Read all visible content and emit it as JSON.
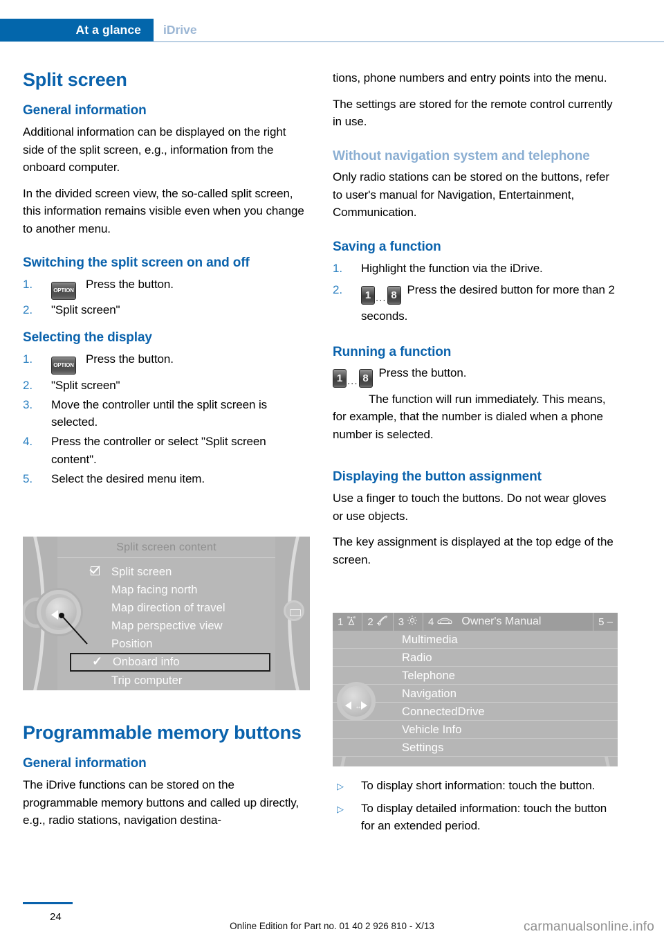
{
  "header": {
    "active_tab": "At a glance",
    "inactive_tab": "iDrive"
  },
  "colors": {
    "brand_blue": "#0366ab",
    "heading_blue": "#0a62ac",
    "heading_blue_light": "#8aaed2",
    "number_blue": "#2a7fc0"
  },
  "left_column": {
    "title": "Split screen",
    "sections": [
      {
        "heading": "General information",
        "paragraphs": [
          "Additional information can be displayed on the right side of the split screen, e.g., information from the onboard computer.",
          "In the divided screen view, the so-called split screen, this information remains visible even when you change to another menu."
        ]
      },
      {
        "heading": "Switching the split screen on and off",
        "steps": [
          {
            "num": "1.",
            "icon": "OPTION",
            "text": "Press the button."
          },
          {
            "num": "2.",
            "text": "\"Split screen\""
          }
        ]
      },
      {
        "heading": "Selecting the display",
        "steps": [
          {
            "num": "1.",
            "icon": "OPTION",
            "text": "Press the button."
          },
          {
            "num": "2.",
            "text": "\"Split screen\""
          },
          {
            "num": "3.",
            "text": "Move the controller until the split screen is selected."
          },
          {
            "num": "4.",
            "text": "Press the controller or select \"Split screen content\"."
          },
          {
            "num": "5.",
            "text": "Select the desired menu item."
          }
        ]
      }
    ],
    "title2": "Programmable memory buttons",
    "section2": {
      "heading": "General information",
      "paragraph": "The iDrive functions can be stored on the programmable memory buttons and called up directly, e.g., radio stations, navigation destina-"
    }
  },
  "figure_split_screen": {
    "title": "Split screen content",
    "items": [
      {
        "label": "Split screen",
        "marker": "checkbox-checked",
        "selected": false
      },
      {
        "label": "Map facing north",
        "marker": "none",
        "selected": false
      },
      {
        "label": "Map direction of travel",
        "marker": "none",
        "selected": false
      },
      {
        "label": "Map perspective view",
        "marker": "none",
        "selected": false
      },
      {
        "label": "Position",
        "marker": "none",
        "selected": false
      },
      {
        "label": "Onboard info",
        "marker": "tick",
        "selected": true
      },
      {
        "label": "Trip computer",
        "marker": "none",
        "selected": false
      }
    ]
  },
  "right_column": {
    "continued_paragraphs": [
      "tions, phone numbers and entry points into the menu.",
      "The settings are stored for the remote control currently in use."
    ],
    "sections": [
      {
        "heading": "Without navigation system and telephone",
        "heading_style": "light",
        "paragraphs": [
          "Only radio stations can be stored on the buttons, refer to user's manual for Navigation, Entertainment, Communication."
        ]
      },
      {
        "heading": "Saving a function",
        "steps": [
          {
            "num": "1.",
            "text": "Highlight the function via the iDrive."
          },
          {
            "num": "2.",
            "icon": "memory-buttons-1-to-8",
            "text": "Press the desired button for more than 2 seconds."
          }
        ]
      },
      {
        "heading": "Running a function",
        "inline_icon": "memory-buttons-1-to-8",
        "lines": [
          "Press the button.",
          "The function will run immediately. This means, for example, that the number is dialed when a phone number is selected."
        ]
      },
      {
        "heading": "Displaying the button assignment",
        "paragraphs": [
          "Use a finger to touch the buttons. Do not wear gloves or use objects.",
          "The key assignment is displayed at the top edge of the screen."
        ]
      }
    ],
    "arrow_items": [
      "To display short information: touch the button.",
      "To display detailed information: touch the button for an extended period."
    ]
  },
  "memory_keys": {
    "first": "1",
    "last": "8",
    "dots": "..."
  },
  "figure_owners_manual": {
    "topbar": [
      {
        "num": "1",
        "icon": "radio-antenna-icon"
      },
      {
        "num": "2",
        "icon": "telephone-icon"
      },
      {
        "num": "3",
        "icon": "gear-icon"
      },
      {
        "num": "4",
        "icon": "car-icon"
      }
    ],
    "topbar_title": "Owner's Manual",
    "topbar_last": "5 –",
    "rows": [
      "Multimedia",
      "Radio",
      "Telephone",
      "Navigation",
      "ConnectedDrive",
      "Vehicle Info",
      "Settings"
    ]
  },
  "footer": {
    "page_number": "24",
    "edition": "Online Edition for Part no. 01 40 2 926 810 - X/13",
    "watermark": "carmanualsonline.info"
  }
}
